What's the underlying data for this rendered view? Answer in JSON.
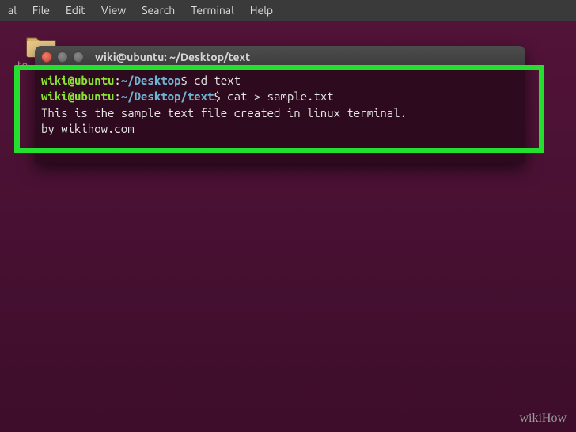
{
  "menubar": {
    "items": [
      "al",
      "File",
      "Edit",
      "View",
      "Search",
      "Terminal",
      "Help"
    ]
  },
  "desktop": {
    "bg_label_partial": "te"
  },
  "window": {
    "title": "wiki@ubuntu: ~/Desktop/text"
  },
  "terminal": {
    "lines": [
      {
        "user": "wiki@ubuntu",
        "path": "~/Desktop",
        "dollar": "$",
        "cmd": "cd text"
      },
      {
        "user": "wiki@ubuntu",
        "path": "~/Desktop/text",
        "dollar": "$",
        "cmd": "cat > sample.txt"
      }
    ],
    "output": [
      "This is the sample text file created in linux terminal.",
      "by wikihow.com"
    ],
    "colon": ":"
  },
  "watermark": "wikiHow"
}
